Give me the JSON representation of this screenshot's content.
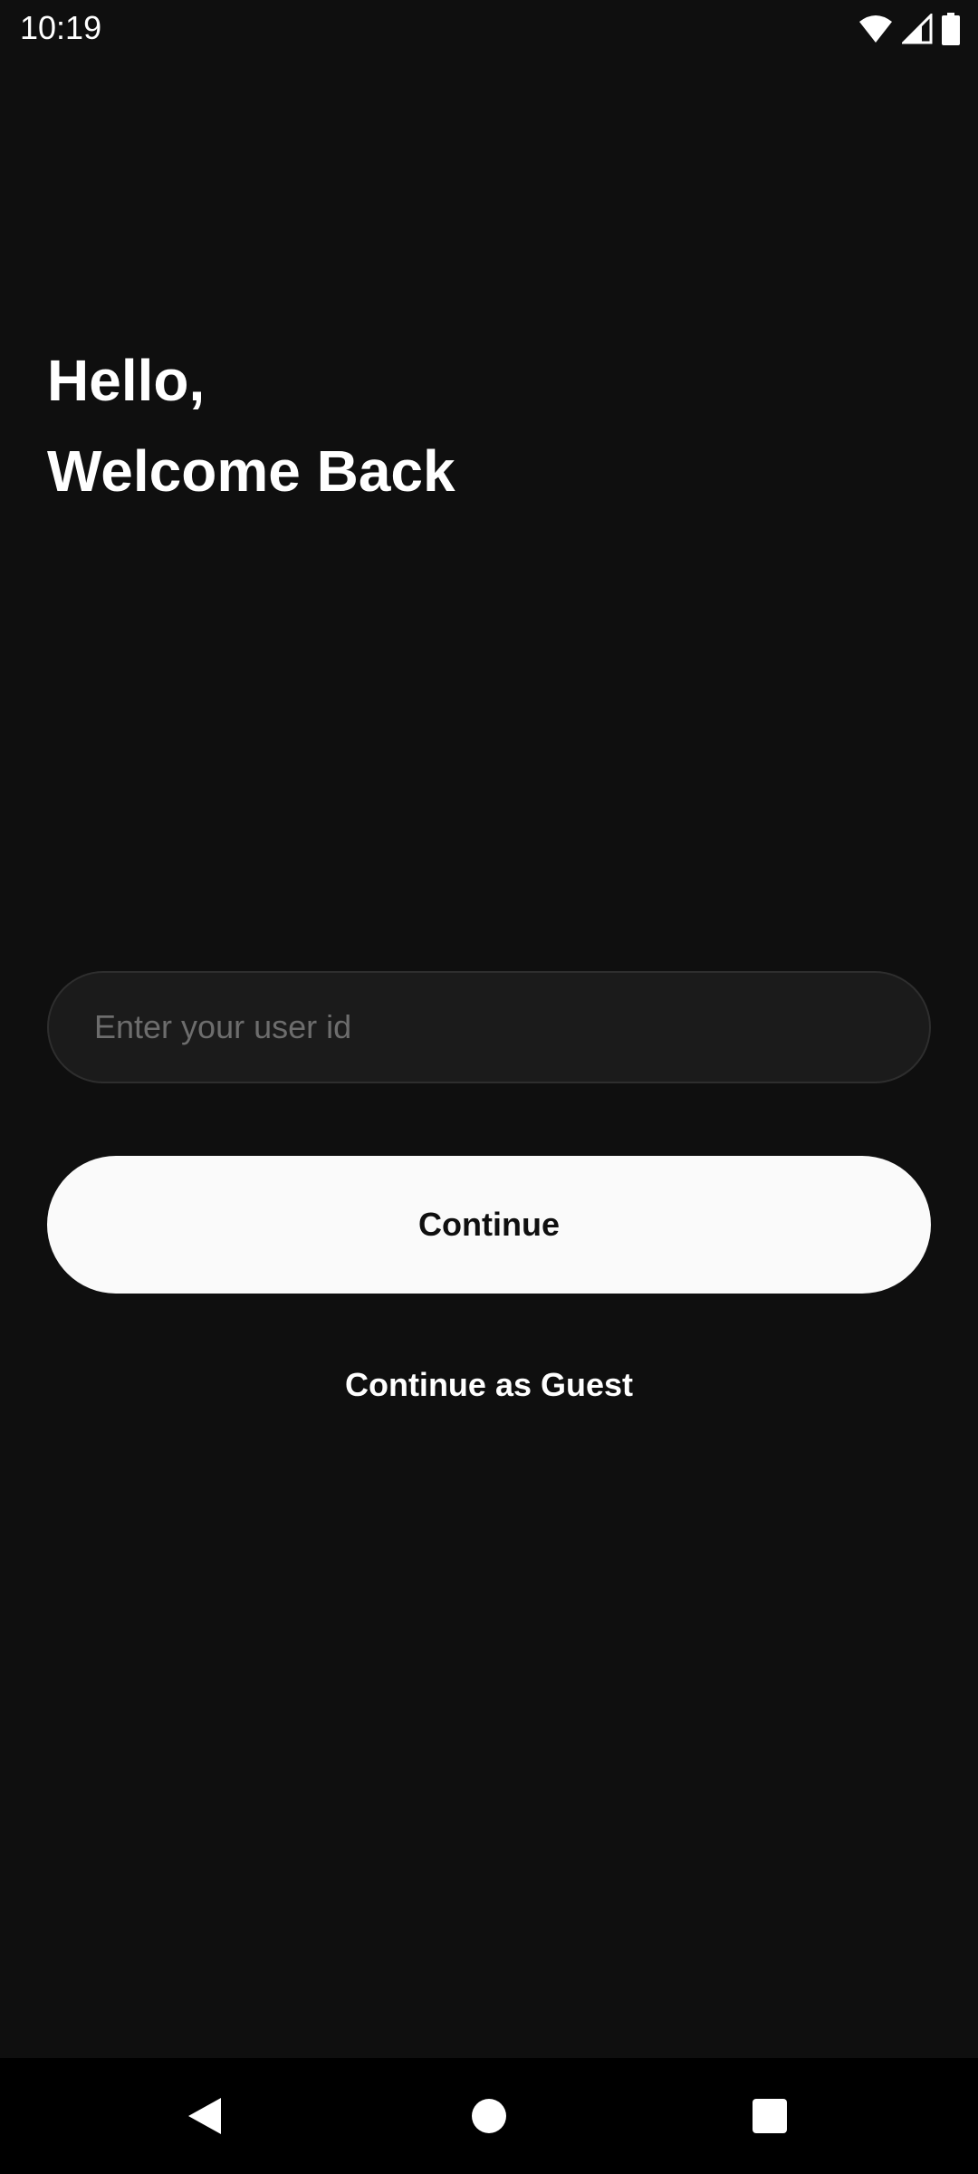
{
  "status_bar": {
    "time": "10:19",
    "icons": [
      "wifi-icon",
      "signal-icon",
      "battery-icon"
    ]
  },
  "greeting": {
    "line1": "Hello,",
    "line2": "Welcome Back"
  },
  "login": {
    "userid_placeholder": "Enter your user id",
    "userid_value": "",
    "continue_label": "Continue",
    "guest_label": "Continue as Guest"
  },
  "nav_bar": {
    "buttons": [
      "back-icon",
      "home-icon",
      "recents-icon"
    ]
  },
  "colors": {
    "background": "#0f0f0f",
    "input_background": "#1b1b1b",
    "input_border": "#2e2e2e",
    "button_background": "#fafafa",
    "text_primary": "#ffffff",
    "placeholder": "#6d6d6d"
  }
}
